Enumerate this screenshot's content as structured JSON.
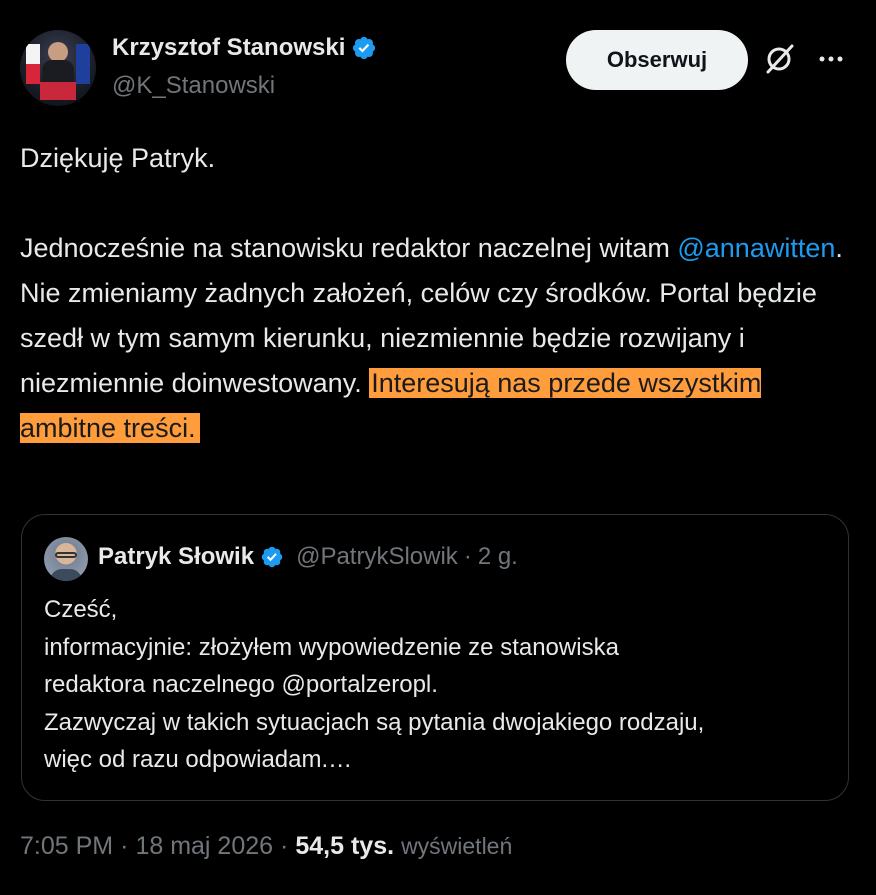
{
  "author": {
    "display_name": "Krzysztof Stanowski",
    "handle": "@K_Stanowski"
  },
  "actions": {
    "follow_label": "Obserwuj",
    "grok_icon": "grok-icon",
    "more_icon": "more-options-icon"
  },
  "tweet": {
    "line1": "Dziękuję Patryk.",
    "para2_start": "Jednocześnie na stanowisku redaktor naczelnej witam ",
    "mention": "@annawitten",
    "para2_mid": ". Nie zmieniamy żadnych założeń, celów czy środków. Portal będzie szedł w tym samym kierunku, niezmiennie będzie rozwijany i niezmiennie doinwestowany. ",
    "highlighted": "Interesują nas przede wszystkim ambitne treści."
  },
  "quote": {
    "display_name": "Patryk Słowik",
    "handle": "@PatrykSlowik",
    "separator": "·",
    "time": "2 g.",
    "lines": [
      "Cześć,",
      "informacyjnie: złożyłem wypowiedzenie ze stanowiska",
      "redaktora naczelnego @portalzeropl.",
      "Zazwyczaj w takich sytuacjach są pytania dwojakiego rodzaju,",
      "więc od razu odpowiadam.…"
    ]
  },
  "meta": {
    "time": "7:05 PM",
    "sep1": "·",
    "date": "18 maj 2026",
    "sep2": "·",
    "views_count": "54,5 tys.",
    "views_label": "wyświetleń"
  },
  "colors": {
    "background": "#000000",
    "text": "#e7e9ea",
    "muted": "#71767b",
    "link": "#1d9bf0",
    "verified": "#1d9bf0",
    "highlight": "#ff9c3c",
    "button_bg": "#eff3f4"
  }
}
